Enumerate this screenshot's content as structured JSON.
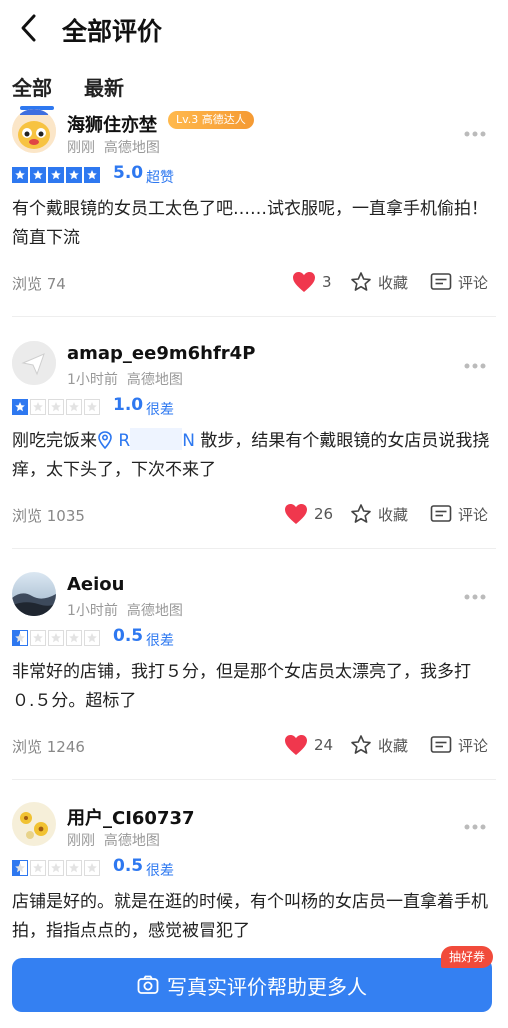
{
  "header": {
    "title": "全部评价"
  },
  "tabs": [
    {
      "label": "全部"
    },
    {
      "label": "最新"
    }
  ],
  "reviews": [
    {
      "username": "海狮住亦埜",
      "badge": "Lv.3 高德达人",
      "time": "刚刚",
      "source": "高德地图",
      "rating": 5,
      "score": "5.0",
      "score_label": "超赞",
      "text": "有个戴眼镜的女员工太色了吧……试衣服呢，一直拿手机偷拍！简直下流",
      "views": "浏览 74",
      "likes": "3",
      "fav_label": "收藏",
      "comment_label": "评论"
    },
    {
      "username": "amap_ee9m6hfr4P",
      "time": "1小时前",
      "source": "高德地图",
      "rating": 1,
      "score": "1.0",
      "score_label": "很差",
      "text_before": "刚吃完饭来",
      "location_start": "R",
      "location_end": "N",
      "text_after": " 散步，结果有个戴眼镜的女店员说我挠痒，太下头了，下次不来了",
      "views": "浏览 1035",
      "likes": "26",
      "fav_label": "收藏",
      "comment_label": "评论"
    },
    {
      "username": "Aeiou",
      "time": "1小时前",
      "source": "高德地图",
      "rating": 0.5,
      "score": "0.5",
      "score_label": "很差",
      "text": "非常好的店铺，我打５分，但是那个女店员太漂亮了，我多打０.５分。超标了",
      "views": "浏览 1246",
      "likes": "24",
      "fav_label": "收藏",
      "comment_label": "评论"
    },
    {
      "username": "用户_CI60737",
      "time": "刚刚",
      "source": "高德地图",
      "rating": 0.5,
      "score": "0.5",
      "score_label": "很差",
      "text": "店铺是好的。就是在逛的时候，有个叫杨的女店员一直拿着手机拍，指指点点的，感觉被冒犯了"
    }
  ],
  "cta": {
    "label": "写真实评价帮助更多人",
    "coupon": "抽好券"
  },
  "colors": {
    "accent": "#2e78f0",
    "like": "#f0374d",
    "coupon": "#f14b3b"
  }
}
